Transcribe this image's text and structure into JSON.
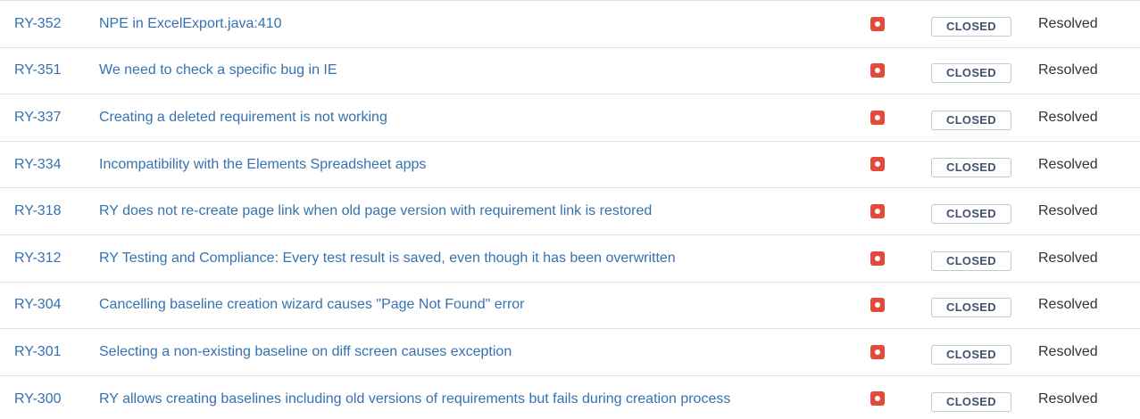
{
  "issues": [
    {
      "key": "RY-352",
      "summary": "NPE in ExcelExport.java:410",
      "priority_icon": "priority-highest-icon",
      "status": "CLOSED",
      "resolution": "Resolved"
    },
    {
      "key": "RY-351",
      "summary": "We need to check a specific bug in IE",
      "priority_icon": "priority-highest-icon",
      "status": "CLOSED",
      "resolution": "Resolved"
    },
    {
      "key": "RY-337",
      "summary": "Creating a deleted requirement is not working",
      "priority_icon": "priority-highest-icon",
      "status": "CLOSED",
      "resolution": "Resolved"
    },
    {
      "key": "RY-334",
      "summary": "Incompatibility with the Elements Spreadsheet apps",
      "priority_icon": "priority-highest-icon",
      "status": "CLOSED",
      "resolution": "Resolved"
    },
    {
      "key": "RY-318",
      "summary": "RY does not re-create page link when old page version with requirement link is restored",
      "priority_icon": "priority-highest-icon",
      "status": "CLOSED",
      "resolution": "Resolved"
    },
    {
      "key": "RY-312",
      "summary": "RY Testing and Compliance: Every test result is saved, even though it has been overwritten",
      "priority_icon": "priority-highest-icon",
      "status": "CLOSED",
      "resolution": "Resolved"
    },
    {
      "key": "RY-304",
      "summary": "Cancelling baseline creation wizard causes \"Page Not Found\" error",
      "priority_icon": "priority-highest-icon",
      "status": "CLOSED",
      "resolution": "Resolved"
    },
    {
      "key": "RY-301",
      "summary": "Selecting a non-existing baseline on diff screen causes exception",
      "priority_icon": "priority-highest-icon",
      "status": "CLOSED",
      "resolution": "Resolved"
    },
    {
      "key": "RY-300",
      "summary": "RY allows creating baselines including old versions of requirements but fails during creation process",
      "priority_icon": "priority-highest-icon",
      "status": "CLOSED",
      "resolution": "Resolved"
    }
  ],
  "colors": {
    "link": "#3572b0",
    "priority_highest": "#e5493a",
    "lozenge_border": "#c1c7d0",
    "lozenge_text": "#42526e",
    "row_border": "#dfe1e5"
  }
}
